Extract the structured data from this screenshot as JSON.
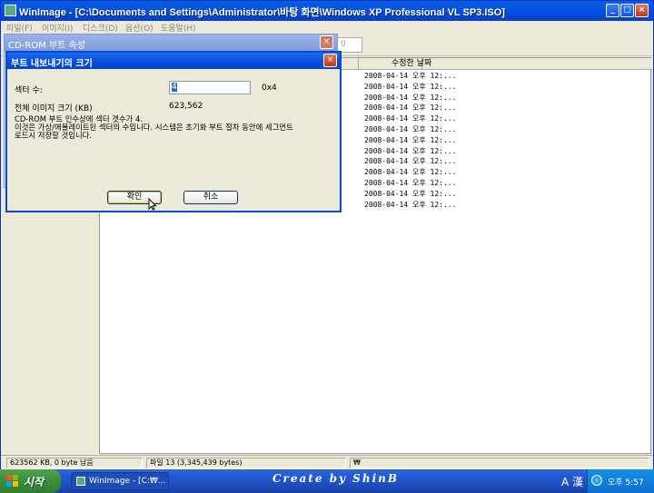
{
  "window": {
    "title": "WinImage - [C:\\Documents and Settings\\Administrator\\바탕 화면\\Windows XP Professional VL SP3.ISO]",
    "minimize": "_",
    "maximize": "□",
    "close": "×"
  },
  "menu": [
    "파일(F)",
    "이미지(I)",
    "디스크(D)",
    "옵션(O)",
    "도움말(H)"
  ],
  "toolbar": {
    "field_value": "0"
  },
  "file_list": {
    "date_header": "수정한 날짜",
    "rows": [
      "2008-04-14  오후 12:...",
      "2008-04-14  오후 12:...",
      "2008-04-14  오후 12:...",
      "2008-04-14  오후 12:...",
      "2008-04-14  오후 12:...",
      "2008-04-14  오후 12:...",
      "2008-04-14  오후 12:...",
      "2008-04-14  오후 12:...",
      "2008-04-14  오후 12:...",
      "2008-04-14  오후 12:...",
      "2008-04-14  오후 12:...",
      "2008-04-14  오후 12:...",
      "2008-04-14  오후 12:..."
    ]
  },
  "bg_dialog": {
    "title": "CD-ROM 부트 속성",
    "close": "×"
  },
  "dialog": {
    "title": "부트 내보내기의 크기",
    "close": "×",
    "sector_label": "섹터 수:",
    "sector_value": "4",
    "sector_hex": "0x4",
    "image_size_label": "전체 이미지 크기 (KB)",
    "image_size_value": "623,562",
    "message_line1": "CD-ROM 부트 인수상에 섹터 갯수가 4.",
    "message_line2": "이것은 가상/에뮬레이트된 섹터의 수입니다. 시스템은 초기화 부트 절차 동안에 세그먼트",
    "message_line3": "로드시 저장할 것입니다.",
    "ok_label": "확인",
    "cancel_label": "취소"
  },
  "status": {
    "size_info": "623562 KB, 0 byte 남음",
    "file_info": "파일 13 (3,345,439 bytes)",
    "path_info": "₩"
  },
  "taskbar": {
    "start_label": "시작",
    "task_label": "WinImage - [C:₩...",
    "brand": "Create by ShinB",
    "lang": "A 漢",
    "clock": "오후 5:57"
  }
}
